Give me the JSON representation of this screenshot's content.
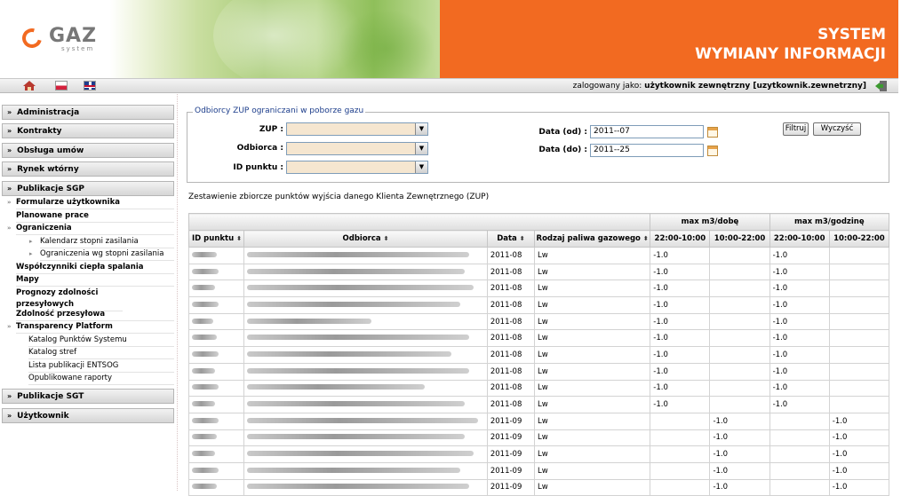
{
  "header": {
    "logo_text": "GAZ",
    "logo_sub": "system",
    "title_line1": "SYSTEM",
    "title_line2": "WYMIANY INFORMACJI"
  },
  "toolbar": {
    "login_prefix": "zalogowany jako:",
    "login_user": "użytkownik zewnętrzny [uzytkownik.zewnetrzny]"
  },
  "sidebar": {
    "menu": [
      {
        "label": "Administracja"
      },
      {
        "label": "Kontrakty"
      },
      {
        "label": "Obsługa umów"
      },
      {
        "label": "Rynek wtórny"
      },
      {
        "label": "Publikacje SGP"
      }
    ],
    "sub": [
      {
        "label": "Formularze użytkownika"
      },
      {
        "label": "Planowane prace"
      },
      {
        "label": "Ograniczenia"
      },
      {
        "label": "Kalendarz stopni zasilania"
      },
      {
        "label": "Ograniczenia wg stopni zasilania"
      },
      {
        "label": "Współczynniki ciepła spalania"
      },
      {
        "label": "Mapy"
      },
      {
        "label": "Prognozy zdolności przesyłowych"
      },
      {
        "label": "Zdolność przesyłowa"
      },
      {
        "label": "Transparency Platform"
      },
      {
        "label": "Katalog Punktów Systemu"
      },
      {
        "label": "Katalog stref"
      },
      {
        "label": "Lista publikacji ENTSOG"
      },
      {
        "label": "Opublikowane raporty"
      }
    ],
    "menu2": [
      {
        "label": "Publikacje SGT"
      },
      {
        "label": "Użytkownik"
      }
    ]
  },
  "filter": {
    "legend": "Odbiorcy ZUP ograniczani w poborze gazu",
    "zup_label": "ZUP :",
    "odbiorca_label": "Odbiorca :",
    "id_label": "ID punktu :",
    "date_from_label": "Data (od) :",
    "date_from_value": "2011-​-07",
    "date_to_label": "Data (do) :",
    "date_to_value": "2011-​-25",
    "filter_btn": "Filtruj",
    "clear_btn": "Wyczyść"
  },
  "summary": "Zestawienie zbiorcze punktów wyjścia danego Klienta Zewnętrznego (ZUP)",
  "table": {
    "group_day": "max m3/dobę",
    "group_hour": "max m3/godzinę",
    "columns": [
      "ID punktu",
      "Odbiorca",
      "Data",
      "Rodzaj paliwa gazowego",
      "22:00-10:00",
      "10:00-22:00",
      "22:00-10:00",
      "10:00-22:00"
    ],
    "sort_glyph": "⬍",
    "rows": [
      {
        "date": "2011-08",
        "fuel": "Lw",
        "d1": "-1.0",
        "d2": "",
        "h1": "-1.0",
        "h2": ""
      },
      {
        "date": "2011-08",
        "fuel": "Lw",
        "d1": "-1.0",
        "d2": "",
        "h1": "-1.0",
        "h2": ""
      },
      {
        "date": "2011-08",
        "fuel": "Lw",
        "d1": "-1.0",
        "d2": "",
        "h1": "-1.0",
        "h2": ""
      },
      {
        "date": "2011-08",
        "fuel": "Lw",
        "d1": "-1.0",
        "d2": "",
        "h1": "-1.0",
        "h2": ""
      },
      {
        "date": "2011-08",
        "fuel": "Lw",
        "d1": "-1.0",
        "d2": "",
        "h1": "-1.0",
        "h2": ""
      },
      {
        "date": "2011-08",
        "fuel": "Lw",
        "d1": "-1.0",
        "d2": "",
        "h1": "-1.0",
        "h2": ""
      },
      {
        "date": "2011-08",
        "fuel": "Lw",
        "d1": "-1.0",
        "d2": "",
        "h1": "-1.0",
        "h2": ""
      },
      {
        "date": "2011-08",
        "fuel": "Lw",
        "d1": "-1.0",
        "d2": "",
        "h1": "-1.0",
        "h2": ""
      },
      {
        "date": "2011-08",
        "fuel": "Lw",
        "d1": "-1.0",
        "d2": "",
        "h1": "-1.0",
        "h2": ""
      },
      {
        "date": "2011-08",
        "fuel": "Lw",
        "d1": "-1.0",
        "d2": "",
        "h1": "-1.0",
        "h2": ""
      },
      {
        "date": "2011-09",
        "fuel": "Lw",
        "d1": "",
        "d2": "-1.0",
        "h1": "",
        "h2": "-1.0"
      },
      {
        "date": "2011-09",
        "fuel": "Lw",
        "d1": "",
        "d2": "-1.0",
        "h1": "",
        "h2": "-1.0"
      },
      {
        "date": "2011-09",
        "fuel": "Lw",
        "d1": "",
        "d2": "-1.0",
        "h1": "",
        "h2": "-1.0"
      },
      {
        "date": "2011-09",
        "fuel": "Lw",
        "d1": "",
        "d2": "-1.0",
        "h1": "",
        "h2": "-1.0"
      },
      {
        "date": "2011-09",
        "fuel": "Lw",
        "d1": "",
        "d2": "-1.0",
        "h1": "",
        "h2": "-1.0"
      }
    ]
  },
  "colors": {
    "brand_orange": "#f26a21",
    "legend_blue": "#1c3d8b"
  },
  "icons": [
    "home-icon",
    "flag-pl-icon",
    "flag-uk-icon",
    "logout-icon",
    "calendar-icon",
    "dropdown-arrow-icon",
    "sort-icon",
    "chevron-icon"
  ]
}
